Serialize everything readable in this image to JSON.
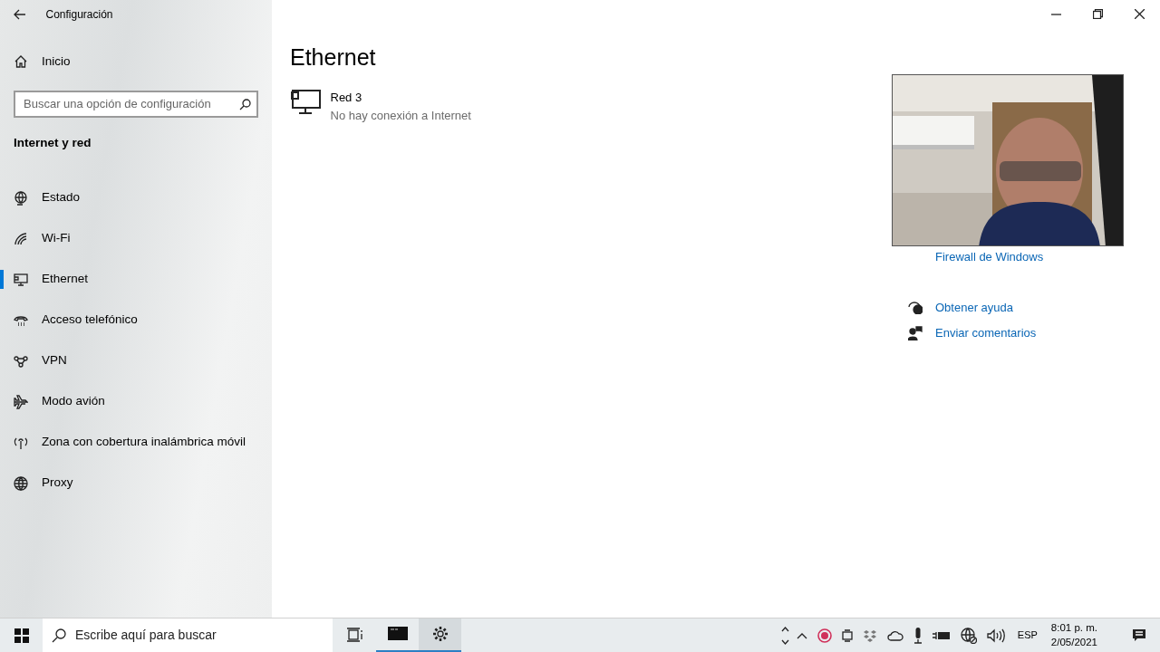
{
  "window": {
    "title": "Configuración"
  },
  "sidebar": {
    "home": "Inicio",
    "search": {
      "placeholder": "Buscar una opción de configuración"
    },
    "section": "Internet y red",
    "items": [
      {
        "label": "Estado",
        "selected": false
      },
      {
        "label": "Wi-Fi",
        "selected": false
      },
      {
        "label": "Ethernet",
        "selected": true
      },
      {
        "label": "Acceso telefónico",
        "selected": false
      },
      {
        "label": "VPN",
        "selected": false
      },
      {
        "label": "Modo avión",
        "selected": false
      },
      {
        "label": "Zona con cobertura inalámbrica móvil",
        "selected": false
      },
      {
        "label": "Proxy",
        "selected": false
      }
    ]
  },
  "page": {
    "title": "Ethernet",
    "network": {
      "name": "Red 3",
      "status": "No hay conexión a Internet"
    }
  },
  "related": {
    "links": [
      "Firewall de Windows"
    ],
    "help": [
      "Obtener ayuda",
      "Enviar comentarios"
    ]
  },
  "taskbar": {
    "search": {
      "placeholder": "Escribe aquí para buscar"
    },
    "apps": [
      {
        "kind": "taskview",
        "running": false
      },
      {
        "kind": "terminal",
        "running": true
      },
      {
        "kind": "settings",
        "running": true
      }
    ],
    "language": "ESP",
    "time": "8:01 p. m.",
    "date": "2/05/2021"
  }
}
